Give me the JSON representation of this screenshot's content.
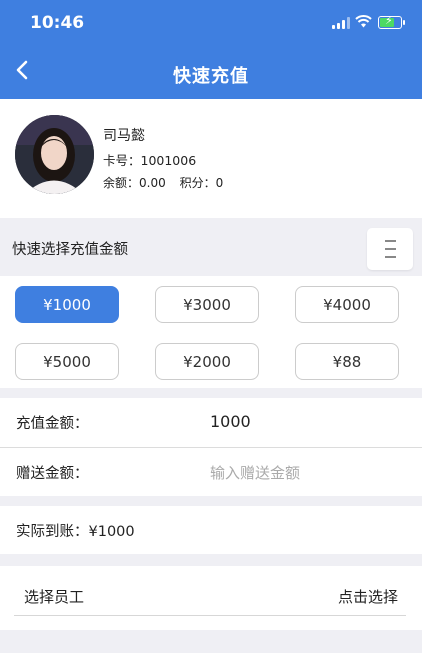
{
  "status": {
    "time": "10:46"
  },
  "header": {
    "title": "快速充值"
  },
  "member": {
    "name": "司马懿",
    "card": "卡号：1001006",
    "balance": "余额：0.00",
    "points": "积分：0"
  },
  "quick": {
    "label": "快速选择充值金额",
    "selected": "¥1000",
    "amounts": [
      "¥1000",
      "¥3000",
      "¥4000",
      "¥5000",
      "¥2000",
      "¥88"
    ]
  },
  "form": {
    "recharge_label": "充值金额：",
    "recharge_value": "1000",
    "gift_label": "赠送金额：",
    "gift_placeholder": "输入赠送金额",
    "actual_label": "实际到账：",
    "actual_value": "¥1000"
  },
  "staff": {
    "label": "选择员工",
    "action": "点击选择"
  },
  "colors": {
    "accent": "#3f7fe0",
    "background": "#efeff4"
  }
}
